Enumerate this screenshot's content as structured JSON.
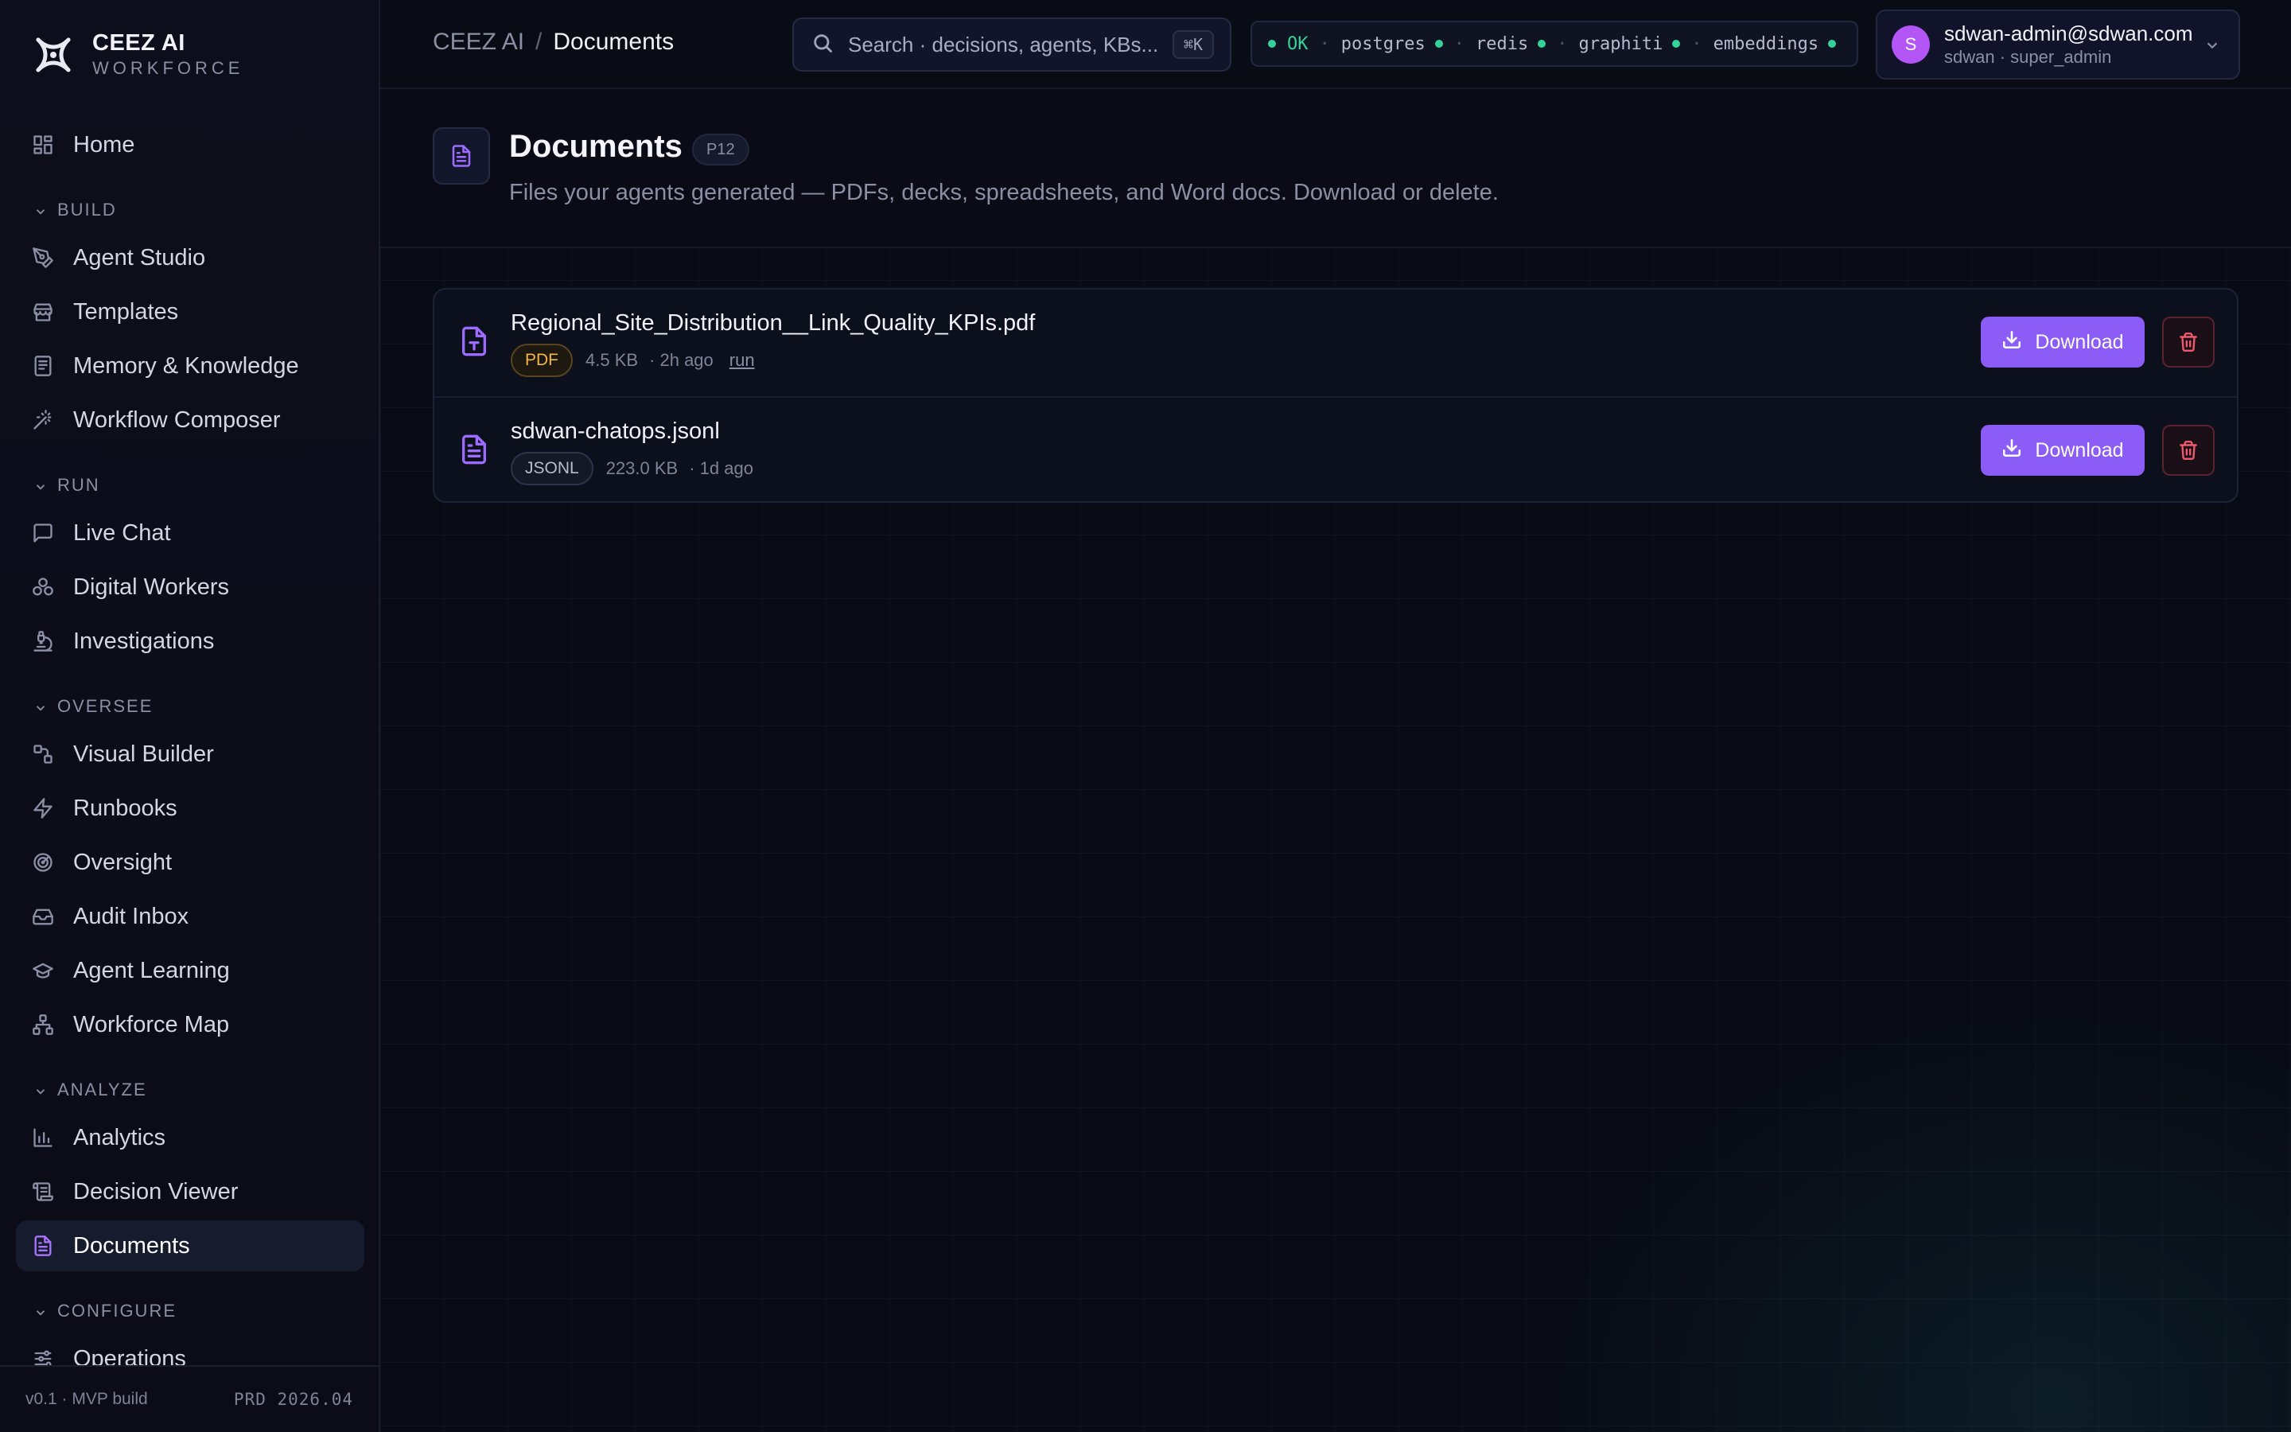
{
  "brand": {
    "name": "CEEZ AI",
    "subtitle": "WORKFORCE"
  },
  "sidebar": {
    "items": [
      {
        "label": "Home",
        "icon": "home-grid-icon"
      },
      {
        "section": "BUILD"
      },
      {
        "label": "Agent Studio",
        "icon": "pen-tool-icon"
      },
      {
        "label": "Templates",
        "icon": "store-icon"
      },
      {
        "label": "Memory & Knowledge",
        "icon": "book-icon"
      },
      {
        "label": "Workflow Composer",
        "icon": "wand-icon"
      },
      {
        "section": "RUN"
      },
      {
        "label": "Live Chat",
        "icon": "chat-icon"
      },
      {
        "label": "Digital Workers",
        "icon": "workers-icon"
      },
      {
        "label": "Investigations",
        "icon": "microscope-icon"
      },
      {
        "section": "OVERSEE"
      },
      {
        "label": "Visual Builder",
        "icon": "nodes-icon"
      },
      {
        "label": "Runbooks",
        "icon": "bolt-icon"
      },
      {
        "label": "Oversight",
        "icon": "radar-icon"
      },
      {
        "label": "Audit Inbox",
        "icon": "inbox-icon"
      },
      {
        "label": "Agent Learning",
        "icon": "graduation-cap-icon"
      },
      {
        "label": "Workforce Map",
        "icon": "org-chart-icon"
      },
      {
        "section": "ANALYZE"
      },
      {
        "label": "Analytics",
        "icon": "bar-chart-icon"
      },
      {
        "label": "Decision Viewer",
        "icon": "scroll-icon"
      },
      {
        "label": "Documents",
        "icon": "document-icon",
        "active": true
      },
      {
        "section": "CONFIGURE"
      },
      {
        "label": "Operations",
        "icon": "sliders-icon"
      }
    ],
    "footer": {
      "version": "v0.1 · MVP build",
      "env": "PRD 2026.04"
    }
  },
  "topbar": {
    "breadcrumb_root": "CEEZ AI",
    "breadcrumb_sep": "/",
    "breadcrumb_current": "Documents",
    "search_placeholder": "Search · decisions, agents, KBs...",
    "search_shortcut": "⌘K",
    "status": {
      "overall": "OK",
      "services": [
        "postgres",
        "redis",
        "graphiti",
        "embeddings"
      ],
      "color_ok": "#34d399"
    },
    "user": {
      "initial": "S",
      "email": "sdwan-admin@sdwan.com",
      "role": "sdwan · super_admin"
    }
  },
  "page": {
    "title": "Documents",
    "badge": "P12",
    "subtitle": "Files your agents generated — PDFs, decks, spreadsheets, and Word docs. Download or delete.",
    "documents": [
      {
        "name": "Regional_Site_Distribution__Link_Quality_KPIs.pdf",
        "type": "PDF",
        "size": "4.5 KB",
        "age": "· 2h ago",
        "link": "run"
      },
      {
        "name": "sdwan-chatops.jsonl",
        "type": "JSONL",
        "size": "223.0 KB",
        "age": "· 1d ago"
      }
    ],
    "download_label": "Download",
    "accent": "#8b5cf6",
    "danger": "#f0596b"
  }
}
